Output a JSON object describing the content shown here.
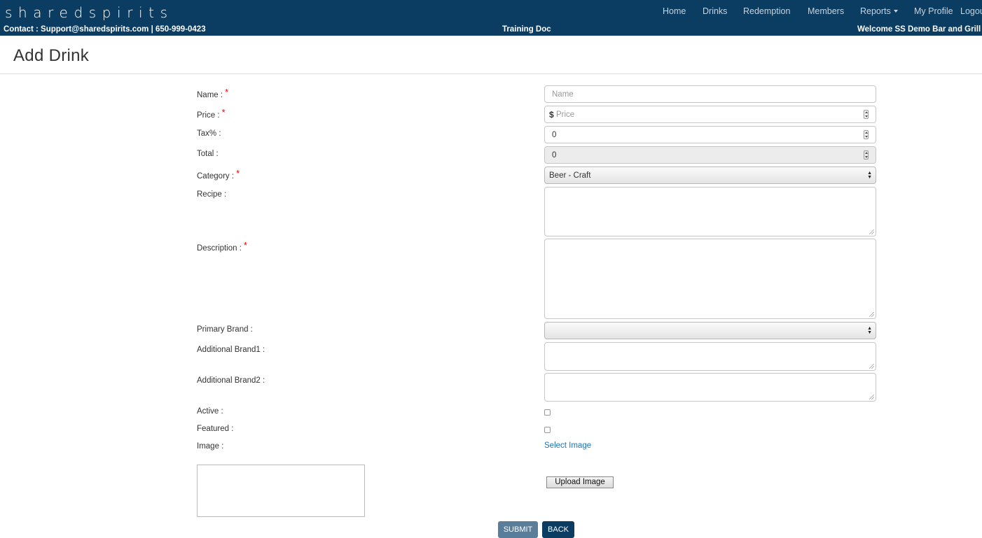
{
  "header": {
    "brand": "sharedspirits",
    "nav": [
      "Home",
      "Drinks",
      "Redemption",
      "Members",
      "Reports",
      "My Profile",
      "Logout"
    ],
    "contact": "Contact : Support@sharedspirits.com | 650-999-0423",
    "training": "Training Doc",
    "welcome": "Welcome SS Demo Bar and Grill"
  },
  "page": {
    "title": "Add Drink"
  },
  "form": {
    "name": {
      "label": "Name :",
      "placeholder": "Name",
      "required": true
    },
    "price": {
      "label": "Price :",
      "prefix": "$",
      "placeholder": "Price",
      "required": true
    },
    "tax": {
      "label": "Tax% :",
      "value": "0"
    },
    "total": {
      "label": "Total :",
      "value": "0"
    },
    "category": {
      "label": "Category :",
      "value": "Beer - Craft",
      "required": true
    },
    "recipe": {
      "label": "Recipe :"
    },
    "description": {
      "label": "Description :",
      "required": true
    },
    "primary_brand": {
      "label": "Primary Brand :",
      "value": ""
    },
    "additional_brand1": {
      "label": "Additional Brand1 :"
    },
    "additional_brand2": {
      "label": "Additional Brand2 :"
    },
    "active": {
      "label": "Active :",
      "checked": false
    },
    "featured": {
      "label": "Featured :",
      "checked": false
    },
    "image": {
      "label": "Image :",
      "select_link": "Select Image",
      "upload_label": "Upload Image"
    },
    "required_mark": "*"
  },
  "actions": {
    "submit": "SUBMIT",
    "back": "BACK"
  },
  "colors": {
    "navbar": "#0b3c61",
    "submit": "#5a7d99",
    "back": "#0b3c61",
    "required": "#e00000",
    "link": "#1a73b8"
  }
}
